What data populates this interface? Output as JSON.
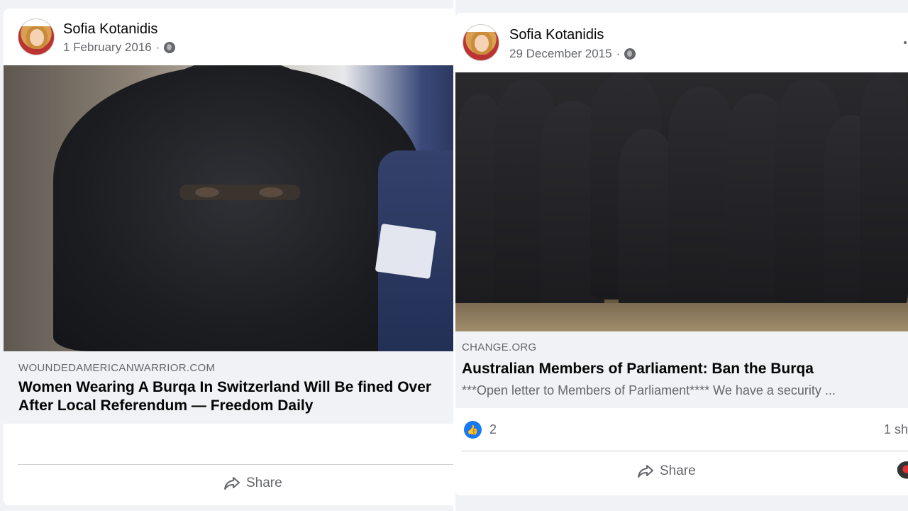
{
  "left_post": {
    "author": "Sofia Kotanidis",
    "date": "1 February 2016",
    "separator": "·",
    "privacy_icon": "globe-icon",
    "link": {
      "domain": "WOUNDEDAMERICANWARRIOR.COM",
      "title": "Women Wearing A Burqa In Switzerland Will Be fined Over After Local Referendum — Freedom Daily"
    },
    "share_label": "Share"
  },
  "right_post": {
    "author": "Sofia Kotanidis",
    "date": "29 December 2015",
    "separator": "·",
    "privacy_icon": "globe-icon",
    "link": {
      "domain": "CHANGE.ORG",
      "title": "Australian Members of Parliament: Ban the Burqa",
      "description": "***Open letter to Members of Parliament**** We have a security ..."
    },
    "reactions": {
      "like_icon": "thumbs-up-icon",
      "like_count": "2",
      "shares_text": "1 sh"
    },
    "share_label": "Share"
  },
  "colors": {
    "facebook_blue": "#1877f2",
    "muted_text": "#65676b",
    "link_box_bg": "#f0f2f5"
  }
}
